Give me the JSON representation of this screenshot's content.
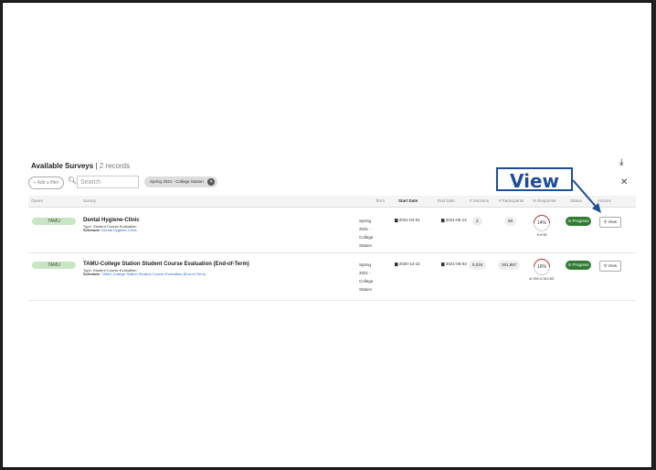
{
  "header": {
    "title": "Available Surveys",
    "separator": "|",
    "record_count": "2 records"
  },
  "filters": {
    "add_filter_label": "+ Add a filter",
    "search_placeholder": "Search",
    "active_chip": "Spring 2021 - College Station"
  },
  "table": {
    "columns": [
      "Owner",
      "Survey",
      "Term",
      "Start Date",
      "End Date",
      "# Sections",
      "# Participants",
      "% Response",
      "Status",
      "Actions"
    ],
    "rows": [
      {
        "owner": "TAMU",
        "title": "Dental Hygiene-Clinic",
        "type": "Type: Student Course Evaluation",
        "schedule_label": "Schedule:",
        "schedule_link": "Dental Hygiene-Clinic",
        "term": "Spring 2021 - College Station",
        "start_date": "2021-04-01",
        "end_date": "2021-05-12",
        "sections": "2",
        "participants": "58",
        "response_pct": "14%",
        "response_sub": "8 of 58",
        "status": "In Progress",
        "action": "View"
      },
      {
        "owner": "TAMU",
        "title": "TAMU-College Station Student Course Evaluation (End-of-Term)",
        "type": "Type: Student Course Evaluation",
        "schedule_label": "Schedule:",
        "schedule_link": "TAMU-College Station Student Course Evaluation (End-of-Term)",
        "term": "Spring 2021 - College Station",
        "start_date": "2020-12-22",
        "end_date": "2021-05-03",
        "sections": "9,034",
        "participants": "261,967",
        "response_pct": "16%",
        "response_sub": "41,909 of 261,967",
        "status": "In Progress",
        "action": "View"
      }
    ]
  },
  "callout": {
    "label": "View"
  },
  "colors": {
    "status_green": "#2e7d32",
    "owner_badge": "#c9e6c4",
    "callout_blue": "#1f4e96",
    "link_blue": "#2a6ad8"
  }
}
